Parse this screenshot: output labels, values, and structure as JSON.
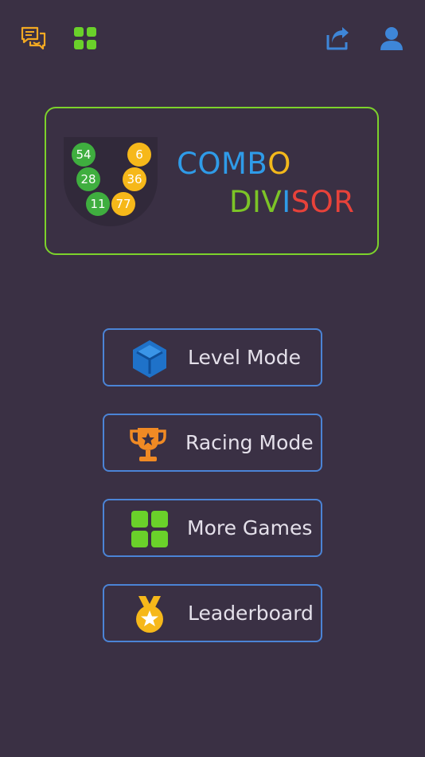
{
  "header": {
    "feedback_icon": "chat-bubbles-icon",
    "apps_icon": "grid-apps-icon",
    "share_icon": "share-icon",
    "account_icon": "user-icon"
  },
  "logo": {
    "balls": {
      "green": [
        "54",
        "28",
        "11"
      ],
      "yellow": [
        "6",
        "36",
        "77"
      ]
    },
    "title_line1": [
      "C",
      "O",
      "M",
      "B",
      "O"
    ],
    "title_line2": [
      "D",
      "I",
      "V",
      "I",
      "S",
      "O",
      "R"
    ],
    "title_colors_line1": [
      "#2f9be8",
      "#2f9be8",
      "#2f9be8",
      "#2f9be8",
      "#f3b81b"
    ],
    "title_colors_line2": [
      "#7cc427",
      "#7cc427",
      "#7cc427",
      "#2f9be8",
      "#e8423a",
      "#e8423a",
      "#e8423a"
    ]
  },
  "menu": [
    {
      "label": "Level Mode",
      "icon": "cube-icon"
    },
    {
      "label": "Racing Mode",
      "icon": "trophy-icon"
    },
    {
      "label": "More Games",
      "icon": "grid-apps-icon"
    },
    {
      "label": "Leaderboard",
      "icon": "medal-icon"
    }
  ],
  "colors": {
    "background": "#3a3044",
    "logo_border": "#7cd22b",
    "button_border": "#4b84d6",
    "green": "#3fae3f",
    "yellow": "#f6b81a",
    "orange": "#f08a24",
    "blue": "#2f82d8",
    "lime": "#6ad12a"
  }
}
